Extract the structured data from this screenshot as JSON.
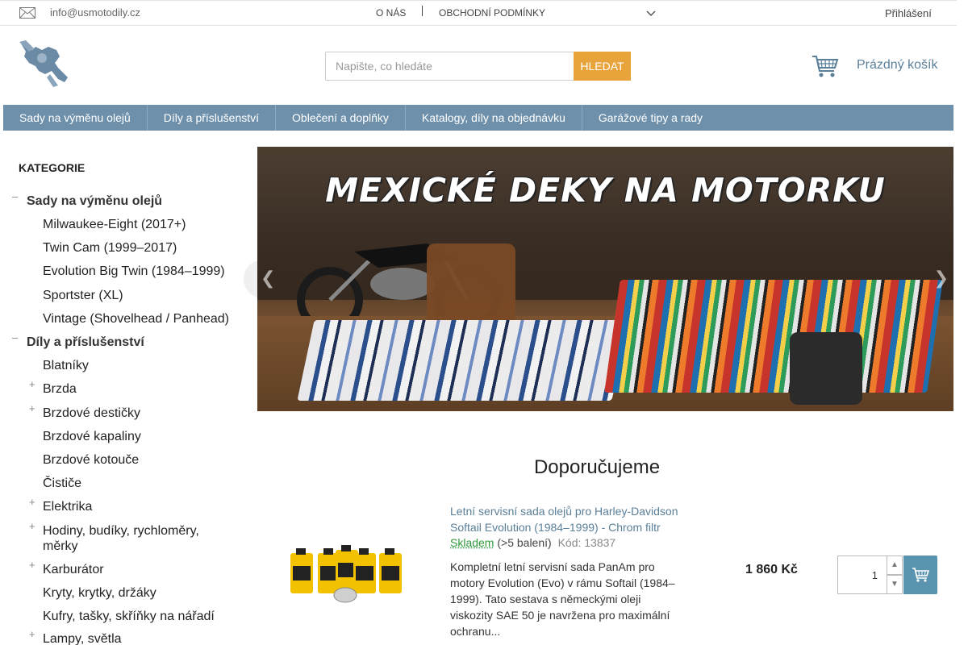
{
  "topbar": {
    "email": "info@usmotodily.cz",
    "nav": [
      "O NÁS",
      "OBCHODNÍ PODMÍNKY"
    ],
    "login": "Přihlášení"
  },
  "header": {
    "search_placeholder": "Napište, co hledáte",
    "search_button": "HLEDAT",
    "cart_label": "Prázdný košík"
  },
  "main_nav": [
    "Sady na výměnu olejů",
    "Díly a příslušenství",
    "Oblečení a doplňky",
    "Katalogy, díly na objednávku",
    "Garážové tipy a rady"
  ],
  "sidebar": {
    "title": "KATEGORIE",
    "items": [
      {
        "label": "Sady na výměnu olejů",
        "level": 0,
        "toggle": "–"
      },
      {
        "label": "Milwaukee-Eight (2017+)",
        "level": 1,
        "toggle": ""
      },
      {
        "label": "Twin Cam (1999–2017)",
        "level": 1,
        "toggle": ""
      },
      {
        "label": "Evolution Big Twin (1984–1999)",
        "level": 1,
        "toggle": ""
      },
      {
        "label": "Sportster (XL)",
        "level": 1,
        "toggle": ""
      },
      {
        "label": "Vintage (Shovelhead / Panhead)",
        "level": 1,
        "toggle": ""
      },
      {
        "label": "Díly a příslušenství",
        "level": 0,
        "toggle": "–"
      },
      {
        "label": "Blatníky",
        "level": 1,
        "toggle": ""
      },
      {
        "label": "Brzda",
        "level": 1,
        "toggle": "+"
      },
      {
        "label": "Brzdové destičky",
        "level": 1,
        "toggle": "+"
      },
      {
        "label": "Brzdové kapaliny",
        "level": 1,
        "toggle": ""
      },
      {
        "label": "Brzdové kotouče",
        "level": 1,
        "toggle": ""
      },
      {
        "label": "Čističe",
        "level": 1,
        "toggle": ""
      },
      {
        "label": "Elektrika",
        "level": 1,
        "toggle": "+"
      },
      {
        "label": "Hodiny, budíky, rychloměry, měrky",
        "level": 1,
        "toggle": "+"
      },
      {
        "label": "Karburátor",
        "level": 1,
        "toggle": "+"
      },
      {
        "label": "Kryty, krytky, držáky",
        "level": 1,
        "toggle": ""
      },
      {
        "label": "Kufry, tašky, skříňky na nářadí",
        "level": 1,
        "toggle": ""
      },
      {
        "label": "Lampy, světla",
        "level": 1,
        "toggle": "+"
      }
    ]
  },
  "banner": {
    "title": "MEXICKÉ DEKY NA MOTORKU"
  },
  "recommended": {
    "title": "Doporučujeme",
    "product": {
      "name": "Letní servisní sada olejů pro Harley-Davidson Softail Evolution (1984–1999) - Chrom filtr",
      "stock": "Skladem",
      "pack": "(>5 balení)",
      "code": "Kód: 13837",
      "description": "Kompletní letní servisní sada PanAm pro motory Evolution (Evo) v rámu Softail (1984–1999). Tato sestava s německými oleji viskozity SAE 50 je navržena pro maximální ochranu...",
      "price": "1 860 Kč",
      "quantity": "1"
    }
  }
}
